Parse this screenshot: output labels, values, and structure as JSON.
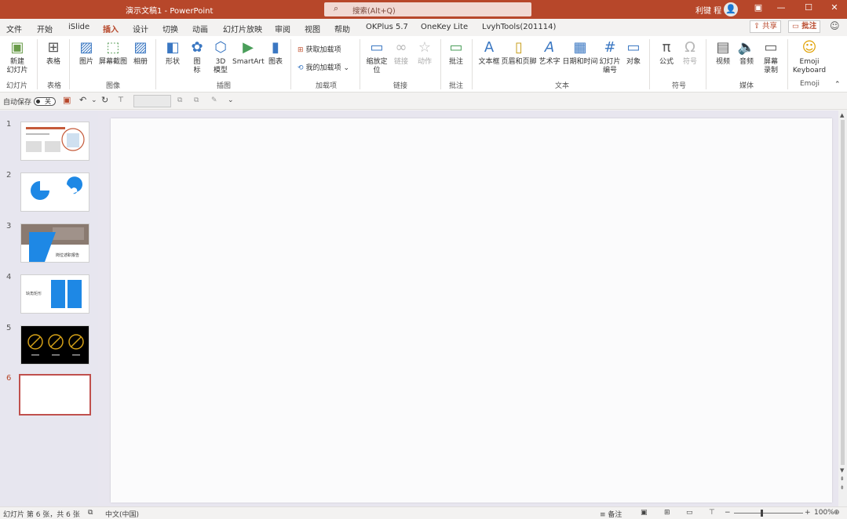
{
  "titlebar": {
    "doc_title": "演示文稿1  -  PowerPoint",
    "search_placeholder": "搜索(Alt+Q)",
    "user_name": "利键 程",
    "colors": {
      "bar": "#b7472a",
      "accent": "#b7472a",
      "thumb_selected_border": "#c0504d"
    }
  },
  "tabs": [
    "文件",
    "开始",
    "iSlide",
    "设计",
    "插入",
    "切换",
    "动画",
    "幻灯片放映",
    "审阅",
    "视图",
    "帮助",
    "OKPlus 5.7",
    "OneKey Lite",
    "LvyhTools(201114)"
  ],
  "tab_share": "共享",
  "tab_comment": "批注",
  "ribbon": {
    "new_slide": "新建\n幻灯片",
    "table": "表格",
    "picture": "图片",
    "screenshot": "屏幕截图",
    "album": "相册",
    "shapes": "形状",
    "icons": "图\n标",
    "model3d": "3D\n模型",
    "smartart": "SmartArt",
    "chart": "图表",
    "get_addins": "获取加载项",
    "my_addins": "我的加载项",
    "zoom": "缩放定\n位",
    "link": "链接",
    "action": "动作",
    "comment": "批注",
    "textbox": "文本框",
    "header_footer": "页眉和页脚",
    "wordart": "艺术字",
    "datetime": "日期和时间",
    "slide_number": "幻灯片\n编号",
    "object": "对象",
    "equation": "公式",
    "symbol": "符号",
    "video": "视频",
    "audio": "音频",
    "screen_record": "屏幕\n录制",
    "emoji": "Emoji\nKeyboard"
  },
  "groups": {
    "slides": "幻灯片",
    "tables": "表格",
    "images": "图像",
    "illustrations": "插图",
    "addins": "加载项",
    "links": "链接",
    "comments": "批注",
    "text": "文本",
    "symbols": "符号",
    "media": "媒体",
    "emoji": "Emoji"
  },
  "qat": {
    "autosave": "自动保存",
    "toggle_state": "关"
  },
  "slides": [
    {
      "number": "1"
    },
    {
      "number": "2",
      "labels": [
        "—",
        "—"
      ]
    },
    {
      "number": "3",
      "caption": "岗位述职报告"
    },
    {
      "number": "4",
      "label": "缺角矩形"
    },
    {
      "number": "5",
      "labels": [
        "—",
        "—",
        "—"
      ]
    },
    {
      "number": "6",
      "selected": true
    }
  ],
  "status": {
    "slide_info": "幻灯片 第 6 张，共 6 张",
    "language": "中文(中国)",
    "notes": "备注",
    "zoom": "100%"
  }
}
